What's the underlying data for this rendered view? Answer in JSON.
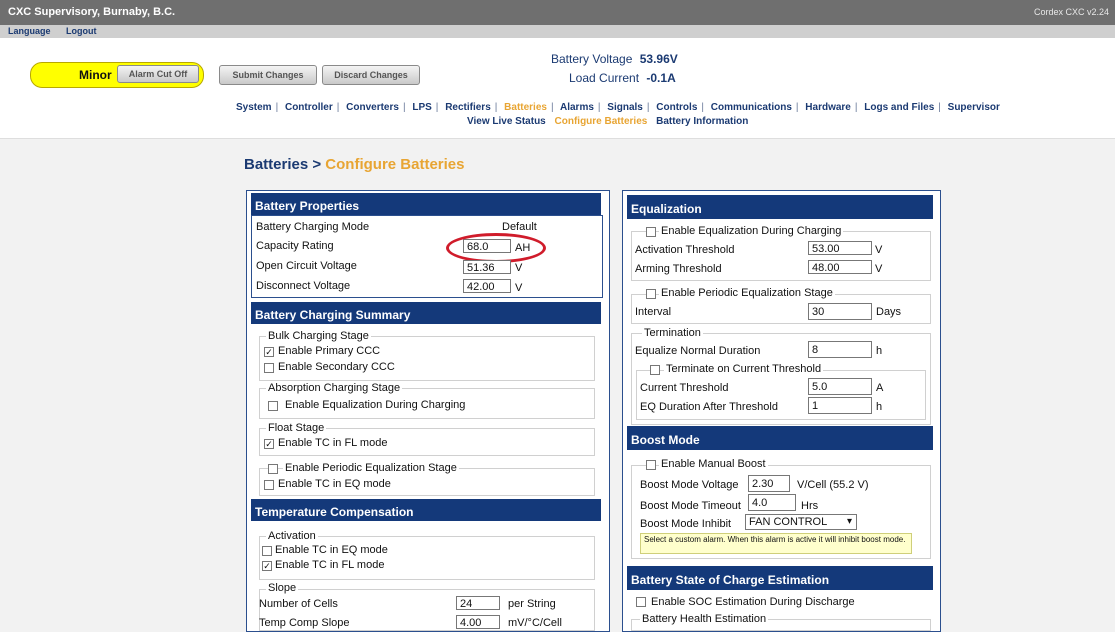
{
  "header": {
    "title": "CXC Supervisory, Burnaby, B.C.",
    "version": "Cordex CXC v2.24"
  },
  "subbar": {
    "language": "Language",
    "logout": "Logout"
  },
  "alarm": {
    "status": "Minor",
    "cutoff": "Alarm Cut Off"
  },
  "actions": {
    "submit": "Submit Changes",
    "discard": "Discard Changes"
  },
  "readouts": {
    "battery_voltage_label": "Battery Voltage",
    "battery_voltage_value": "53.96V",
    "load_current_label": "Load Current",
    "load_current_value": "-0.1A"
  },
  "nav": {
    "main": [
      "System",
      "Controller",
      "Converters",
      "LPS",
      "Rectifiers",
      "Batteries",
      "Alarms",
      "Signals",
      "Controls",
      "Communications",
      "Hardware",
      "Logs and Files",
      "Supervisor"
    ],
    "sub": [
      "View Live Status",
      "Configure Batteries",
      "Battery Information"
    ]
  },
  "page": {
    "crumb": "Batteries >",
    "current": "Configure Batteries"
  },
  "battery_properties": {
    "title": "Battery Properties",
    "charging_mode_label": "Battery Charging Mode",
    "charging_mode_value": "Default",
    "capacity_label": "Capacity Rating",
    "capacity_value": "68.0",
    "capacity_unit": "AH",
    "ocv_label": "Open Circuit Voltage",
    "ocv_value": "51.36",
    "ocv_unit": "V",
    "disconnect_label": "Disconnect Voltage",
    "disconnect_value": "42.00",
    "disconnect_unit": "V"
  },
  "charging_summary": {
    "title": "Battery Charging Summary",
    "bulk": "Bulk Charging Stage",
    "primary": "Enable Primary CCC",
    "secondary": "Enable Secondary CCC",
    "absorption": "Absorption Charging Stage",
    "abs_eq": "Enable Equalization During Charging",
    "float": "Float Stage",
    "float_tc": "Enable TC in FL mode",
    "periodic": "Enable Periodic Equalization Stage",
    "periodic_tc": "Enable TC in EQ mode"
  },
  "temp_comp": {
    "title": "Temperature Compensation",
    "activation": "Activation",
    "eq_mode": "Enable TC in EQ mode",
    "fl_mode": "Enable TC in FL mode",
    "slope": "Slope",
    "cells_label": "Number of Cells",
    "cells_value": "24",
    "cells_unit": "per String",
    "slope_label": "Temp Comp Slope",
    "slope_value": "4.00",
    "slope_unit": "mV/°C/Cell"
  },
  "equalization": {
    "title": "Equalization",
    "enable_during": "Enable Equalization During Charging",
    "activation_label": "Activation Threshold",
    "activation_value": "53.00",
    "activation_unit": "V",
    "arming_label": "Arming Threshold",
    "arming_value": "48.00",
    "arming_unit": "V",
    "periodic": "Enable Periodic Equalization Stage",
    "interval_label": "Interval",
    "interval_value": "30",
    "interval_unit": "Days",
    "termination": "Termination",
    "normal_label": "Equalize Normal Duration",
    "normal_value": "8",
    "normal_unit": "h",
    "on_current": "Terminate on Current Threshold",
    "current_label": "Current Threshold",
    "current_value": "5.0",
    "current_unit": "A",
    "after_label": "EQ Duration After Threshold",
    "after_value": "1",
    "after_unit": "h"
  },
  "boost": {
    "title": "Boost Mode",
    "manual": "Enable Manual Boost",
    "voltage_label": "Boost Mode Voltage",
    "voltage_value": "2.30",
    "voltage_unit": "V/Cell (55.2 V)",
    "timeout_label": "Boost Mode Timeout",
    "timeout_value": "4.0",
    "timeout_unit": "Hrs",
    "inhibit_label": "Boost Mode Inhibit",
    "inhibit_value": "FAN CONTROL",
    "tip": "Select a custom alarm. When this alarm is active it will inhibit boost mode."
  },
  "soc": {
    "title": "Battery State of Charge Estimation",
    "enable": "Enable SOC Estimation During Discharge",
    "health": "Battery Health Estimation"
  },
  "colors": {
    "header_blue": "#14397a",
    "accent_orange": "#e8a533",
    "alarm_yellow": "#ffff00",
    "highlight_red": "#d01c2b"
  }
}
